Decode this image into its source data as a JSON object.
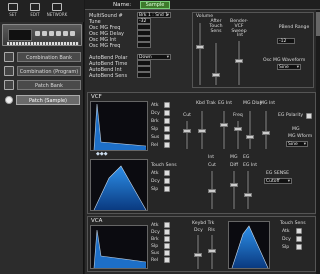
{
  "toolbar": {
    "icons": [
      {
        "name": "set-icon",
        "label": "SET"
      },
      {
        "name": "edit-icon",
        "label": "EDIT"
      },
      {
        "name": "network-icon",
        "label": "NETWORK"
      }
    ]
  },
  "sidebar": {
    "items": [
      {
        "label": "Combination Bank"
      },
      {
        "label": "Combination (Program)"
      },
      {
        "label": "Patch Bank"
      },
      {
        "label": "Patch (Sample)"
      }
    ]
  },
  "header": {
    "name_label": "Name:",
    "name_value": "Sample"
  },
  "params": [
    {
      "label": "MultiSound #",
      "value": "Brk 1 : Snd 1",
      "dropdown": true
    },
    {
      "label": "Tune",
      "value": "-32",
      "dropdown": false
    },
    {
      "label": "Osc MG Freq",
      "value": "",
      "dropdown": false
    },
    {
      "label": "Osc MG Delay",
      "value": "",
      "dropdown": false
    },
    {
      "label": "Osc MG Int",
      "value": "",
      "dropdown": false
    },
    {
      "label": "Osc MG Freq",
      "value": "",
      "dropdown": false
    },
    {
      "label": "AutoBend Polar",
      "value": "Down",
      "dropdown": true
    },
    {
      "label": "AutoBend Time",
      "value": "",
      "dropdown": false
    },
    {
      "label": "AutoBend Int",
      "value": "",
      "dropdown": false
    },
    {
      "label": "AutoBend Sens",
      "value": "",
      "dropdown": false
    }
  ],
  "volume": {
    "title": "Volume",
    "after_touch_sens": "After Touch Sens",
    "bender_vcf_sweep": "Bender-VCF Sweep",
    "int": "Int",
    "pbend_range_label": "PBend Range",
    "pbend_range_value": "-12",
    "osc_mg_waveform_label": "Osc MG Waveform",
    "osc_mg_waveform_value": "Sine"
  },
  "vcf": {
    "title": "VCF",
    "env_labels": [
      "Atk",
      "Dcy",
      "Brk",
      "Slp",
      "Sus",
      "Rel"
    ],
    "touch_sens_label": "Touch Sens",
    "touch_sens_items": [
      "Atk",
      "Dcy",
      "Slp"
    ],
    "cut_label": "Cut",
    "kbd_trak_label": "Kbd Trak",
    "eg_int_label": "EG Int",
    "freq_label": "Freq",
    "mg_dlay_label": "MG Dlay",
    "mg_int_label": "MG Int",
    "eg_polarity_label": "EG Polarity",
    "eg_polarity_value": "+",
    "mg_wform_label": "MG Wform",
    "mg_wform_value": "Sine",
    "int_label": "Int",
    "cut2_label": "Cut",
    "eg_int2_label": "EG Int",
    "cutoff_label": "Cutoff",
    "diff_label": "Diff",
    "mg_label": "MG",
    "eg_label": "EG",
    "kbd_label": "Kbd",
    "eg_sense_label": "EG SENSE",
    "eg_sense_value": "Cutoff"
  },
  "vca": {
    "title": "VCA",
    "env_labels": [
      "Atk",
      "Dcy",
      "Brk",
      "Slp",
      "Sus",
      "Rel"
    ],
    "keybd_trk_label": "Keybd Trk",
    "dcy_label": "Dcy",
    "rls_label": "Rls",
    "touch_sens_label": "Touch Sens",
    "touch_sens_items": [
      "Atk",
      "Dcy",
      "Slp"
    ]
  },
  "colors": {
    "accent_green": "#3d7a2b",
    "env_blue": "#1d6fc8"
  }
}
